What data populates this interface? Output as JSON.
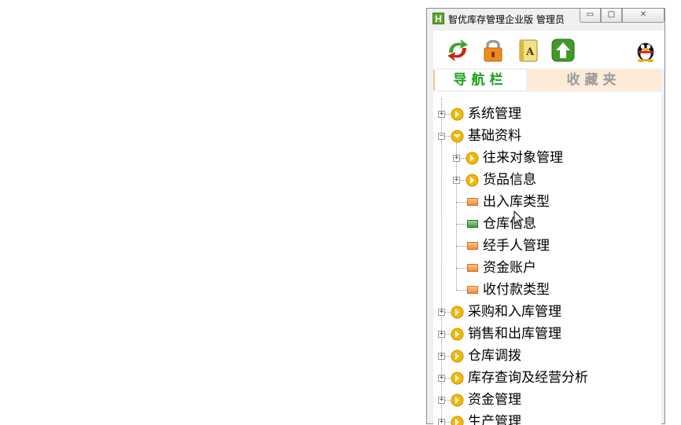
{
  "window": {
    "app_icon_letter": "H",
    "title": "智优库存管理企业版 管理员",
    "controls": {
      "minimize": "▭",
      "maximize": "□",
      "close": "✕"
    }
  },
  "toolbar": {
    "icons": [
      "refresh-arrows-icon",
      "lock-icon",
      "address-book-icon",
      "upload-arrow-icon",
      "qq-penguin-icon"
    ]
  },
  "tabs": {
    "nav": "导航栏",
    "favorites": "收藏夹"
  },
  "tree": [
    {
      "label": "系统管理",
      "level": 0,
      "kind": "folder",
      "expanded": false
    },
    {
      "label": "基础资料",
      "level": 0,
      "kind": "folder",
      "expanded": true
    },
    {
      "label": "往来对象管理",
      "level": 1,
      "kind": "folder",
      "expanded": false
    },
    {
      "label": "货品信息",
      "level": 1,
      "kind": "folder",
      "expanded": false
    },
    {
      "label": "出入库类型",
      "level": 1,
      "kind": "leaf",
      "selected": false
    },
    {
      "label": "仓库信息",
      "level": 1,
      "kind": "leaf",
      "selected": true
    },
    {
      "label": "经手人管理",
      "level": 1,
      "kind": "leaf",
      "selected": false
    },
    {
      "label": "资金账户",
      "level": 1,
      "kind": "leaf",
      "selected": false
    },
    {
      "label": "收付款类型",
      "level": 1,
      "kind": "leaf",
      "selected": false
    },
    {
      "label": "采购和入库管理",
      "level": 0,
      "kind": "folder",
      "expanded": false
    },
    {
      "label": "销售和出库管理",
      "level": 0,
      "kind": "folder",
      "expanded": false
    },
    {
      "label": "仓库调拨",
      "level": 0,
      "kind": "folder",
      "expanded": false
    },
    {
      "label": "库存查询及经营分析",
      "level": 0,
      "kind": "folder",
      "expanded": false
    },
    {
      "label": "资金管理",
      "level": 0,
      "kind": "folder",
      "expanded": false
    },
    {
      "label": "生产管理",
      "level": 0,
      "kind": "folder",
      "expanded": false
    }
  ],
  "colors": {
    "nav_tab_text": "#1aa11a",
    "fav_tab_bg": "#fdebd8",
    "folder_icon": "#f5b800"
  }
}
